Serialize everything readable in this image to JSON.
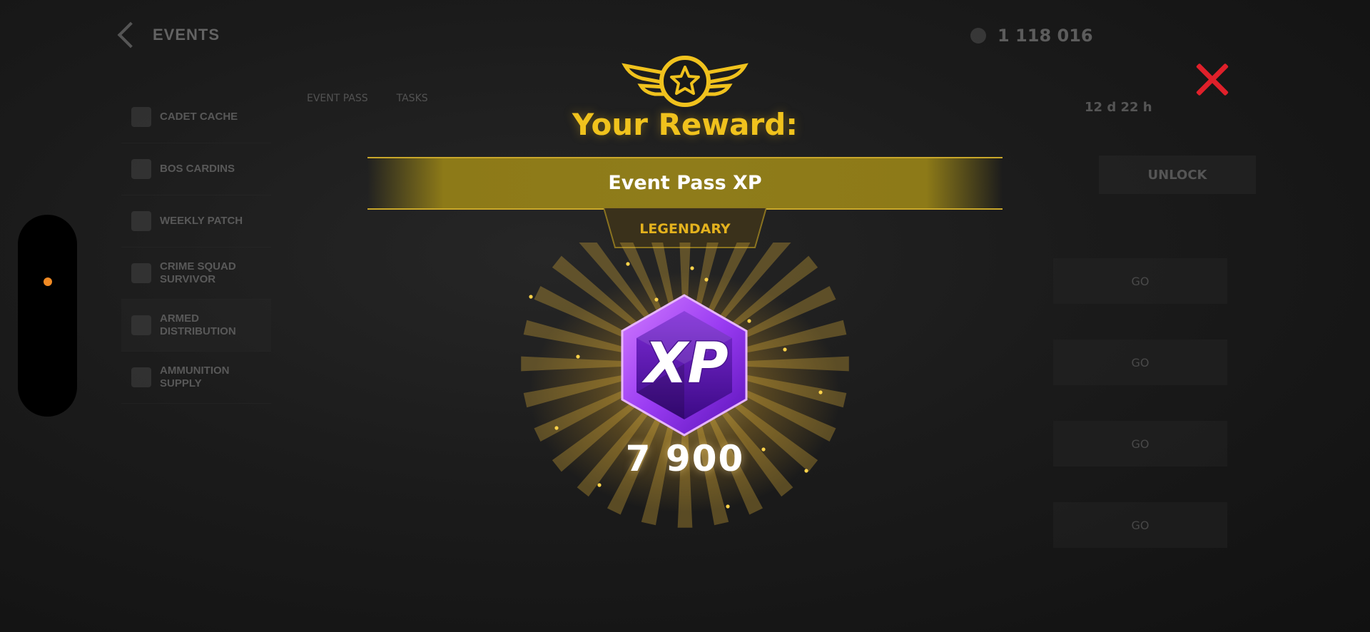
{
  "background": {
    "title": "EVENTS",
    "currency": "1 118 016",
    "sidebar": [
      {
        "label": "CADET CACHE"
      },
      {
        "label": "BOS CARDINS"
      },
      {
        "label": "WEEKLY PATCH"
      },
      {
        "label": "CRIME SQUAD SURVIVOR"
      },
      {
        "label": "ARMED DISTRIBUTION"
      },
      {
        "label": "AMMUNITION SUPPLY"
      }
    ],
    "tabs": [
      "EVENT PASS",
      "TASKS"
    ],
    "timer": "12 d 22 h",
    "cta_label": "UNLOCK",
    "list_buttons": [
      "GO",
      "GO",
      "GO",
      "GO"
    ]
  },
  "modal": {
    "title": "Your Reward:",
    "reward_name": "Event Pass XP",
    "rarity": "LEGENDARY",
    "item_icon": "xp-gem-icon",
    "item_label": "XP",
    "amount": "7 900",
    "close_icon": "close-icon"
  },
  "colors": {
    "gold": "#f0c21d",
    "banner": "#8f7c1a",
    "close": "#e0202a",
    "gem": "#8a2be2"
  }
}
